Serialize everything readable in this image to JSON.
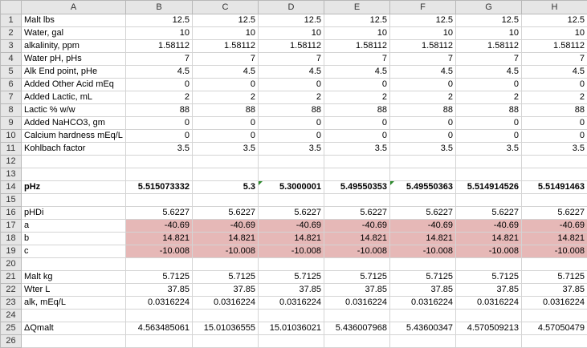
{
  "columns": [
    "A",
    "B",
    "C",
    "D",
    "E",
    "F",
    "G",
    "H"
  ],
  "rows": [
    {
      "num": "1",
      "cells": [
        "Malt lbs",
        "12.5",
        "12.5",
        "12.5",
        "12.5",
        "12.5",
        "12.5",
        "12.5"
      ]
    },
    {
      "num": "2",
      "cells": [
        "Water, gal",
        "10",
        "10",
        "10",
        "10",
        "10",
        "10",
        "10"
      ]
    },
    {
      "num": "3",
      "cells": [
        "alkalinity, ppm",
        "1.58112",
        "1.58112",
        "1.58112",
        "1.58112",
        "1.58112",
        "1.58112",
        "1.58112"
      ]
    },
    {
      "num": "4",
      "cells": [
        "Water pH, pHs",
        "7",
        "7",
        "7",
        "7",
        "7",
        "7",
        "7"
      ]
    },
    {
      "num": "5",
      "cells": [
        "Alk End point, pHe",
        "4.5",
        "4.5",
        "4.5",
        "4.5",
        "4.5",
        "4.5",
        "4.5"
      ]
    },
    {
      "num": "6",
      "cells": [
        "Added Other Acid mEq",
        "0",
        "0",
        "0",
        "0",
        "0",
        "0",
        "0"
      ]
    },
    {
      "num": "7",
      "cells": [
        "Added Lactic, mL",
        "2",
        "2",
        "2",
        "2",
        "2",
        "2",
        "2"
      ]
    },
    {
      "num": "8",
      "cells": [
        "Lactic % w/w",
        "88",
        "88",
        "88",
        "88",
        "88",
        "88",
        "88"
      ]
    },
    {
      "num": "9",
      "cells": [
        "Added NaHCO3, gm",
        "0",
        "0",
        "0",
        "0",
        "0",
        "0",
        "0"
      ]
    },
    {
      "num": "10",
      "cells": [
        "Calcium hardness mEq/L",
        "0",
        "0",
        "0",
        "0",
        "0",
        "0",
        "0"
      ]
    },
    {
      "num": "11",
      "cells": [
        "Kohlbach factor",
        "3.5",
        "3.5",
        "3.5",
        "3.5",
        "3.5",
        "3.5",
        "3.5"
      ]
    },
    {
      "num": "12",
      "cells": [
        "",
        "",
        "",
        "",
        "",
        "",
        "",
        ""
      ]
    },
    {
      "num": "13",
      "cells": [
        "",
        "",
        "",
        "",
        "",
        "",
        "",
        ""
      ]
    },
    {
      "num": "14",
      "cells": [
        "pHz",
        "5.515073332",
        "5.3",
        "5.3000001",
        "5.49550353",
        "5.49550363",
        "5.514914526",
        "5.51491463"
      ]
    },
    {
      "num": "15",
      "cells": [
        "",
        "",
        "",
        "",
        "",
        "",
        "",
        ""
      ]
    },
    {
      "num": "16",
      "cells": [
        "pHDi",
        "5.6227",
        "5.6227",
        "5.6227",
        "5.6227",
        "5.6227",
        "5.6227",
        "5.6227"
      ]
    },
    {
      "num": "17",
      "cells": [
        "a",
        "-40.69",
        "-40.69",
        "-40.69",
        "-40.69",
        "-40.69",
        "-40.69",
        "-40.69"
      ]
    },
    {
      "num": "18",
      "cells": [
        "b",
        "14.821",
        "14.821",
        "14.821",
        "14.821",
        "14.821",
        "14.821",
        "14.821"
      ]
    },
    {
      "num": "19",
      "cells": [
        "c",
        "-10.008",
        "-10.008",
        "-10.008",
        "-10.008",
        "-10.008",
        "-10.008",
        "-10.008"
      ]
    },
    {
      "num": "20",
      "cells": [
        "",
        "",
        "",
        "",
        "",
        "",
        "",
        ""
      ]
    },
    {
      "num": "21",
      "cells": [
        "Malt kg",
        "5.7125",
        "5.7125",
        "5.7125",
        "5.7125",
        "5.7125",
        "5.7125",
        "5.7125"
      ]
    },
    {
      "num": "22",
      "cells": [
        "Wter L",
        "37.85",
        "37.85",
        "37.85",
        "37.85",
        "37.85",
        "37.85",
        "37.85"
      ]
    },
    {
      "num": "23",
      "cells": [
        "alk, mEq/L",
        "0.0316224",
        "0.0316224",
        "0.0316224",
        "0.0316224",
        "0.0316224",
        "0.0316224",
        "0.0316224"
      ]
    },
    {
      "num": "24",
      "cells": [
        "",
        "",
        "",
        "",
        "",
        "",
        "",
        ""
      ]
    },
    {
      "num": "25",
      "cells": [
        "ΔQmalt",
        "4.563485061",
        "15.01036555",
        "15.01036021",
        "5.436007968",
        "5.43600347",
        "4.570509213",
        "4.57050479"
      ]
    },
    {
      "num": "26",
      "cells": [
        "",
        "",
        "",
        "",
        "",
        "",
        "",
        ""
      ]
    }
  ],
  "colors": {
    "highlight": "#e6b8b7",
    "header_bg": "#e6e6e6",
    "error_flag": "#2d8a2d"
  }
}
